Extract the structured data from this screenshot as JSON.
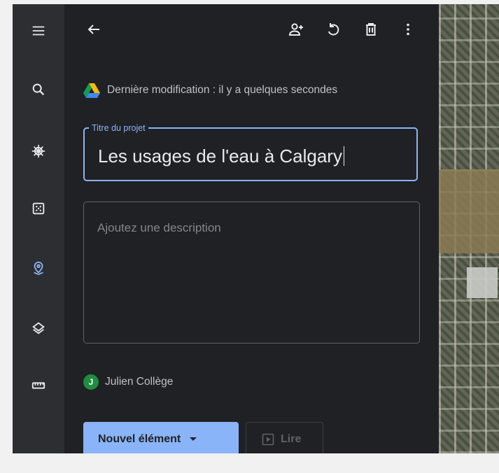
{
  "rail": {
    "items": [
      {
        "icon": "menu-icon"
      },
      {
        "icon": "search-icon"
      },
      {
        "icon": "ship-wheel-icon"
      },
      {
        "icon": "dice-icon"
      },
      {
        "icon": "map-pin-icon",
        "active": true
      },
      {
        "icon": "layers-icon"
      },
      {
        "icon": "ruler-icon"
      }
    ]
  },
  "toolbar": {
    "back_icon": "arrow-left-icon",
    "share_icon": "add-person-icon",
    "undo_icon": "undo-icon",
    "delete_icon": "trash-icon",
    "more_icon": "more-vert-icon"
  },
  "project": {
    "drive_icon": "google-drive-icon",
    "last_modified": "Dernière modification : il y a quelques secondes",
    "title_label": "Titre du projet",
    "title_value": "Les usages de l'eau à Calgary",
    "description_placeholder": "Ajoutez une description",
    "owner_initial": "J",
    "owner_name": "Julien Collège"
  },
  "actions": {
    "new_item_label": "Nouvel élément",
    "play_label": "Lire"
  },
  "colors": {
    "accent": "#8ab4f8",
    "panel_bg": "#202124",
    "rail_bg": "#2d2e31",
    "avatar": "#1e8e3e"
  }
}
